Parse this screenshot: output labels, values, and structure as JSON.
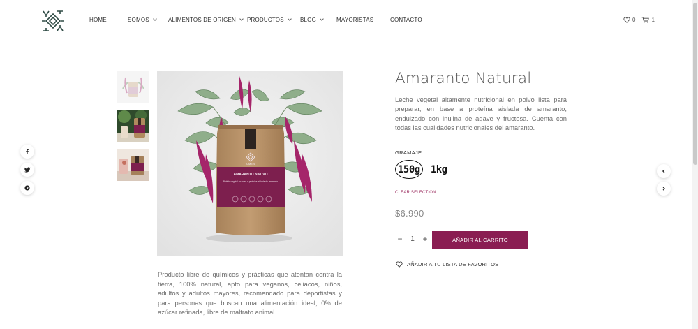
{
  "nav": {
    "items": [
      {
        "label": "HOME",
        "dropdown": false
      },
      {
        "label": "SOMOS",
        "dropdown": true
      },
      {
        "label": "ALIMENTOS DE ORIGEN",
        "dropdown": true
      },
      {
        "label": "PRODUCTOS",
        "dropdown": true
      },
      {
        "label": "BLOG",
        "dropdown": true
      },
      {
        "label": "MAYORISTAS",
        "dropdown": false
      },
      {
        "label": "CONTACTO",
        "dropdown": false
      }
    ],
    "wishlist_count": "0",
    "cart_count": "1"
  },
  "social": {
    "icons": [
      "facebook-icon",
      "twitter-icon",
      "pinterest-icon"
    ]
  },
  "product": {
    "title": "Amaranto Natural",
    "short_description": "Leche vegetal altamente nutricional en polvo lista para preparar, en base a proteína aislada de amaranto, endulzado con inulina de agave y fructosa. Cuenta con todas las cualidades nutricionales del amaranto.",
    "attribute_label": "GRAMAJE",
    "options": [
      {
        "label": "150g",
        "selected": true
      },
      {
        "label": "1kg",
        "selected": false
      }
    ],
    "clear_selection": "CLEAR SELECTION",
    "price": "$6.990",
    "quantity": "1",
    "add_to_cart": "AÑADIR AL CARRITO",
    "wishlist": "AÑADIR A TU LISTA DE FAVORITOS",
    "long_description": "Producto libre de químicos y prácticas que atentan contra la tierra, 100% natural, apto para veganos, celiacos, niños, adultos y adultos mayores, recomendado para deportistas y para personas que buscan una alimentación ideal, 0% de azúcar refinada, libre de maltrato animal."
  },
  "package": {
    "brand": "UMEN",
    "product_name": "AMARANTO NATIVO",
    "subtitle": "Bebida vegetal en base a proteína aislada de amaranto"
  },
  "colors": {
    "accent": "#8a1d52",
    "clear_selection": "#9b2c5f",
    "logo": "#2f4b45"
  }
}
